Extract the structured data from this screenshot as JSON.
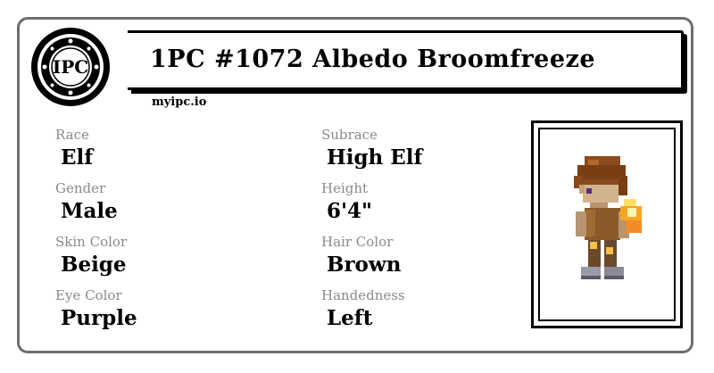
{
  "logo": {
    "text": "IPC",
    "icon": "ipc-logo-icon"
  },
  "title": "1PC #1072 Albedo Broomfreeze",
  "site": "myipc.io",
  "fields": [
    {
      "label": "Race",
      "value": "Elf"
    },
    {
      "label": "Subrace",
      "value": "High Elf"
    },
    {
      "label": "Gender",
      "value": "Male"
    },
    {
      "label": "Height",
      "value": "6'4\""
    },
    {
      "label": "Skin Color",
      "value": "Beige"
    },
    {
      "label": "Hair Color",
      "value": "Brown"
    },
    {
      "label": "Eye Color",
      "value": "Purple"
    },
    {
      "label": "Handedness",
      "value": "Left"
    }
  ],
  "colors": {
    "border": "#6e6e6e",
    "label": "#8a8a8a",
    "text": "#000000"
  }
}
